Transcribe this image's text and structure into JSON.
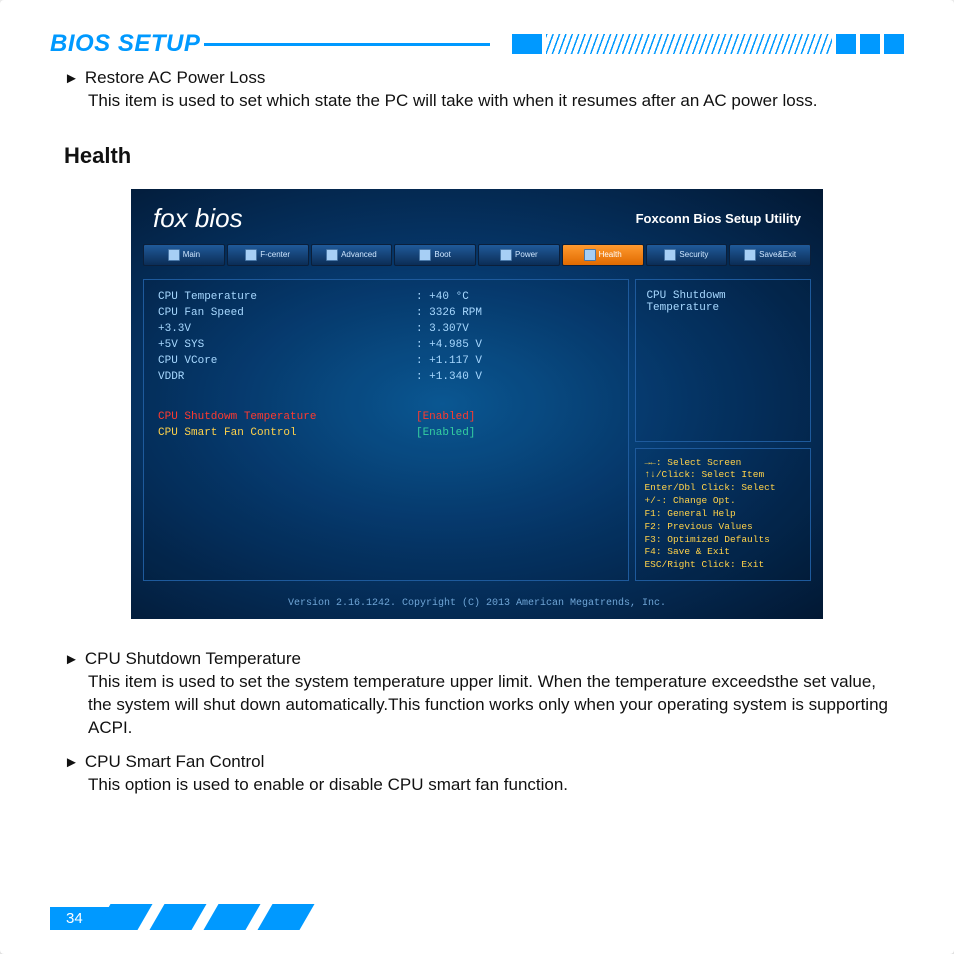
{
  "header": {
    "title": "BIOS SETUP"
  },
  "items_top": [
    {
      "title": "Restore AC Power Loss",
      "desc": "This item is used to set which state the PC will take with when it resumes after an AC power loss."
    }
  ],
  "section_heading": "Health",
  "bios": {
    "logo": "fox bios",
    "subtitle": "Foxconn Bios Setup Utility",
    "tabs": [
      "Main",
      "F-center",
      "Advanced",
      "Boot",
      "Power",
      "Health",
      "Security",
      "Save&Exit"
    ],
    "active_tab": "Health",
    "readings": [
      {
        "label": "CPU Temperature",
        "value": ": +40 °C"
      },
      {
        "label": "CPU Fan Speed",
        "value": ": 3326 RPM"
      },
      {
        "label": "+3.3V",
        "value": ": 3.307V"
      },
      {
        "label": "+5V SYS",
        "value": ": +4.985 V"
      },
      {
        "label": "CPU VCore",
        "value": ": +1.117 V"
      },
      {
        "label": "VDDR",
        "value": ": +1.340 V"
      }
    ],
    "options": [
      {
        "label": "CPU Shutdowm Temperature",
        "value": "[Enabled]",
        "highlight": true
      },
      {
        "label": "CPU Smart Fan Control",
        "value": "[Enabled]",
        "highlight": false
      }
    ],
    "help_top": "CPU Shutdowm Temperature",
    "help_lines": [
      "→←: Select Screen",
      "↑↓/Click: Select Item",
      "Enter/Dbl Click: Select",
      "+/-: Change Opt.",
      "F1: General Help",
      "F2: Previous Values",
      "F3: Optimized Defaults",
      "F4: Save & Exit",
      "ESC/Right Click: Exit"
    ],
    "footer": "Version 2.16.1242. Copyright (C) 2013 American Megatrends, Inc."
  },
  "items_bottom": [
    {
      "title": "CPU Shutdown Temperature",
      "desc": "This item is used to set the system temperature upper limit. When the temperature exceedsthe set value, the system will shut down automatically.This function works only when your operating system is supporting ACPI."
    },
    {
      "title": "CPU Smart Fan Control",
      "desc": "This option is used to enable or disable CPU smart fan function."
    }
  ],
  "page_number": "34"
}
